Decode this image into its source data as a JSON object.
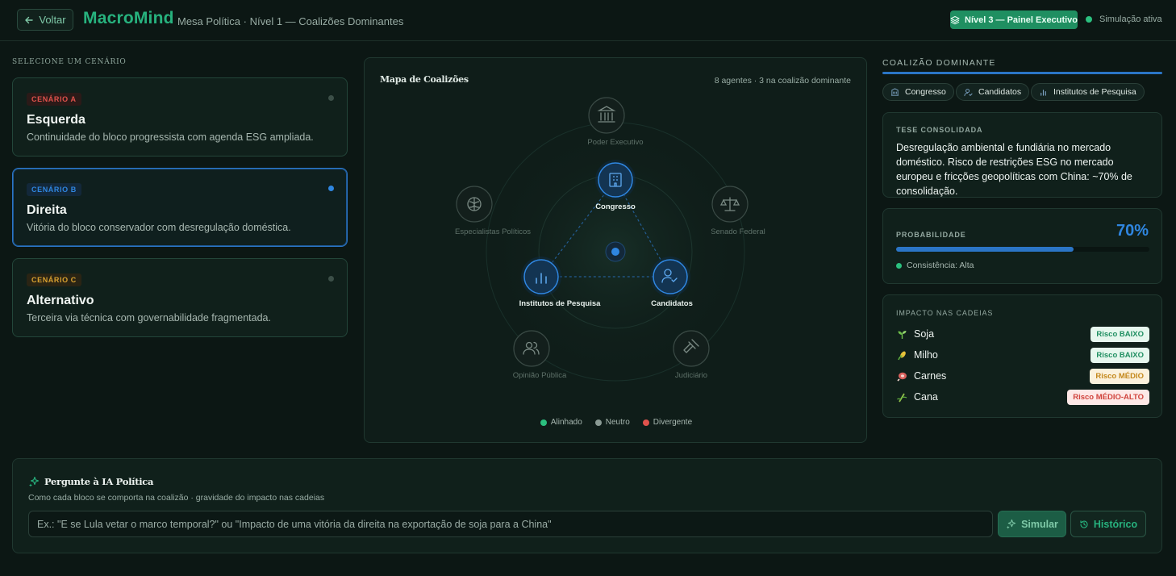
{
  "header": {
    "back_label": "Voltar",
    "brand": "MacroMind",
    "breadcrumb": "Mesa Política · Nível 1 — Coalizões Dominantes",
    "level_badge": "Nível 3 — Painel Executivo",
    "sim_status": "Simulação ativa"
  },
  "scenarios": {
    "title": "Selecione um cenário",
    "items": [
      {
        "tag": "CENÁRIO A",
        "name": "Esquerda",
        "desc": "Continuidade do bloco progressista com agenda ESG ampliada.",
        "tag_color": "#e0524c",
        "active": false
      },
      {
        "tag": "CENÁRIO B",
        "name": "Direita",
        "desc": "Vitória do bloco conservador com desregulação doméstica.",
        "tag_color": "#2f86e0",
        "active": true
      },
      {
        "tag": "CENÁRIO C",
        "name": "Alternativo",
        "desc": "Terceira via técnica com governabilidade fragmentada.",
        "tag_color": "#d9a130",
        "active": false
      }
    ]
  },
  "map": {
    "title": "Mapa de Coalizões",
    "stats": "8 agentes · 3 na coalizão dominante",
    "nodes": {
      "executivo": {
        "label": "Poder Executivo",
        "icon": "landmark-icon",
        "state": "neutral"
      },
      "congresso": {
        "label": "Congresso",
        "icon": "building-icon",
        "state": "dominant"
      },
      "especialistas": {
        "label": "Especialistas Políticos",
        "icon": "brain-icon",
        "state": "neutral"
      },
      "senado": {
        "label": "Senado Federal",
        "icon": "scale-icon",
        "state": "neutral"
      },
      "institutos": {
        "label": "Institutos de Pesquisa",
        "icon": "bar-chart-icon",
        "state": "dominant"
      },
      "candidatos": {
        "label": "Candidatos",
        "icon": "user-check-icon",
        "state": "dominant"
      },
      "opiniao": {
        "label": "Opinião Pública",
        "icon": "users-icon",
        "state": "neutral"
      },
      "judiciario": {
        "label": "Judiciário",
        "icon": "gavel-icon",
        "state": "neutral"
      }
    },
    "legend": [
      {
        "label": "Alinhado",
        "color": "#2bc07f"
      },
      {
        "label": "Neutro",
        "color": "#8a9a94"
      },
      {
        "label": "Divergente",
        "color": "#e0524c"
      }
    ]
  },
  "coalition": {
    "title": "COALIZÃO DOMINANTE",
    "chips": [
      "Congresso",
      "Candidatos",
      "Institutos de Pesquisa"
    ],
    "thesis_label": "TESE CONSOLIDADA",
    "thesis_text": "Desregulação ambiental e fundiária no mercado doméstico. Risco de restrições ESG no mercado europeu e fricções geopolíticas com China: ~70% de consolidação.",
    "probability_label": "PROBABILIDADE",
    "probability_value": "70%",
    "probability_fraction": 0.7,
    "consistency": "Consistência: Alta",
    "impact_label": "IMPACTO NAS CADEIAS",
    "chains": [
      {
        "name": "Soja",
        "icon": "sprout-icon",
        "risk": "Risco BAIXO",
        "risk_color": "#1f8f61",
        "risk_bg": "#e6f7ee"
      },
      {
        "name": "Milho",
        "icon": "corn-icon",
        "risk": "Risco BAIXO",
        "risk_color": "#1f8f61",
        "risk_bg": "#e6f7ee"
      },
      {
        "name": "Carnes",
        "icon": "meat-icon",
        "risk": "Risco MÉDIO",
        "risk_color": "#c4881b",
        "risk_bg": "#fbf1dc"
      },
      {
        "name": "Cana",
        "icon": "cane-icon",
        "risk": "Risco MÉDIO-ALTO",
        "risk_color": "#d0433c",
        "risk_bg": "#fde8e6"
      }
    ]
  },
  "ai": {
    "title": "Pergunte à IA Política",
    "subtitle": "Como cada bloco se comporta na coalizão · gravidade do impacto nas cadeias",
    "placeholder": "Ex.: \"E se Lula vetar o marco temporal?\" ou \"Impacto de uma vitória da direita na exportação de soja para a China\"",
    "simulate_label": "Simular",
    "history_label": "Histórico"
  }
}
